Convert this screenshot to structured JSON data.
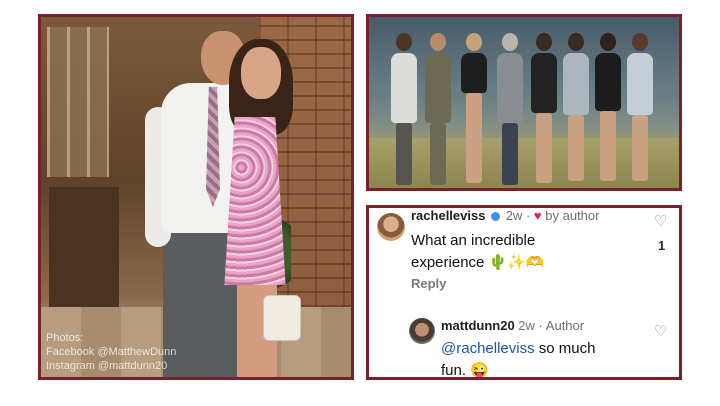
{
  "left_photo": {
    "credit_lines": [
      "Photos:",
      "Facebook @MatthewDunn",
      "Instagram @mattdunn20"
    ]
  },
  "comments": [
    {
      "username": "rachelleviss",
      "time": "2w",
      "meta_suffix": "by author",
      "text_lines": [
        "What an incredible",
        "experience 🌵✨🫶"
      ],
      "like_count": "1",
      "reply_label": "Reply"
    },
    {
      "username": "mattdunn20",
      "time": "2w",
      "meta_suffix": "Author",
      "mention": "@rachelleviss",
      "text_after_mention": " so much",
      "text_line2": "fun. 😜"
    }
  ],
  "colors": {
    "frame": "#7a1f2b",
    "mention_blue": "#1a56b0",
    "heart_red": "#e0245e"
  }
}
